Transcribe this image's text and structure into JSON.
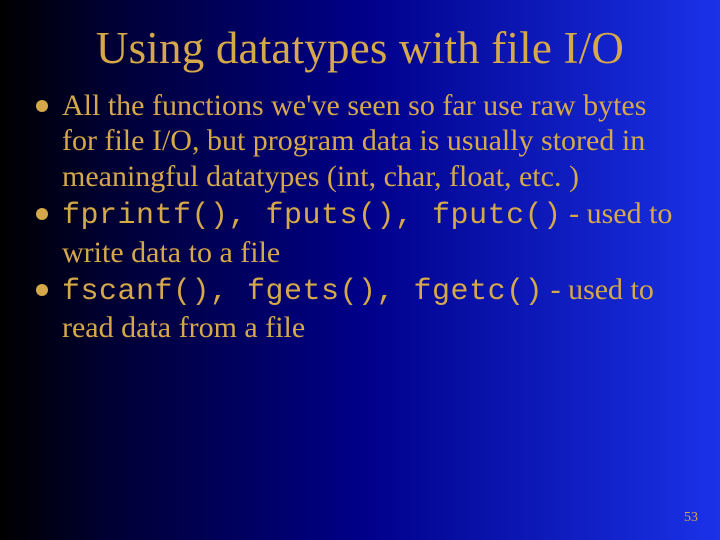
{
  "title": "Using datatypes with file I/O",
  "bullets": {
    "b1": {
      "text": "All the functions we've seen so far use raw bytes for file I/O, but program data is usually stored in meaningful datatypes (int, char, float, etc. )"
    },
    "b2": {
      "code": "fprintf(), fputs(), fputc()",
      "rest": " - used to write data to a file"
    },
    "b3": {
      "code": "fscanf(), fgets(), fgetc()",
      "rest": " - used to read data from a file"
    }
  },
  "pagenum": "53"
}
